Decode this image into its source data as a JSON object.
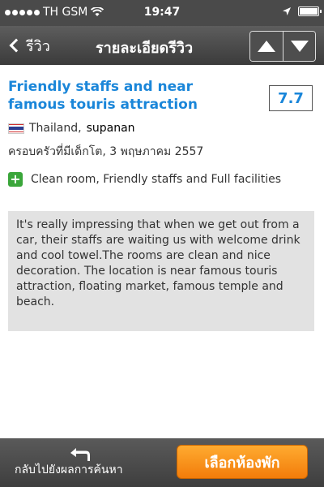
{
  "status_bar": {
    "carrier": "TH GSM",
    "time": "19:47"
  },
  "nav": {
    "back_label": "รีวิว",
    "title": "รายละเอียดรีวิว"
  },
  "review": {
    "title": "Friendly staffs and near famous touris attraction",
    "score": "7.7",
    "country": "Thailand,",
    "reviewer": "supanan",
    "traveler_type_date": "ครอบครัวที่มีเด็กโต, 3 พฤษภาคม 2557",
    "pros": "Clean room, Friendly staffs and Full facilities",
    "body": "It's really impressing that when we get out from a car, their staffs are waiting us with welcome drink and cool towel.The rooms are clean and nice decoration. The location is near famous touris attraction, floating market, famous temple and beach."
  },
  "bottom": {
    "back_to_results": "กลับไปยังผลการค้นหา",
    "book_room": "เลือกห้องพัก"
  },
  "colors": {
    "accent_blue": "#1a86d9",
    "button_orange": "#f27c0a",
    "pros_green": "#3aa63a"
  },
  "icons": [
    "signal-dots-icon",
    "wifi-icon",
    "location-arrow-icon",
    "battery-icon",
    "back-chevron-icon",
    "arrow-up-icon",
    "arrow-down-icon",
    "thailand-flag-icon",
    "plus-icon",
    "return-icon"
  ]
}
